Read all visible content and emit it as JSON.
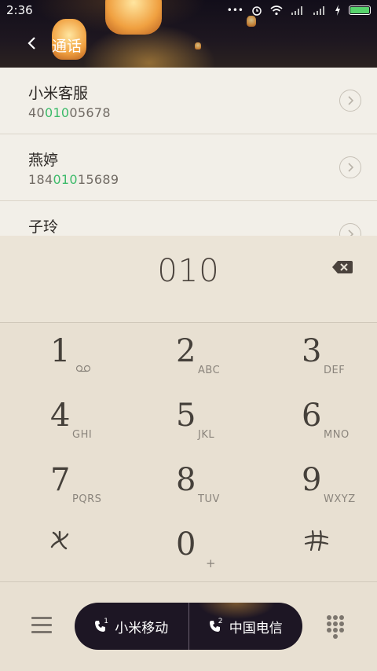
{
  "status_bar": {
    "time": "2:36"
  },
  "header": {
    "title": "通话"
  },
  "results": [
    {
      "name": "小米客服",
      "number_pre": "40",
      "number_match": "010",
      "number_post": "05678"
    },
    {
      "name": "燕婷",
      "number_pre": "184",
      "number_match": "010",
      "number_post": "15689"
    },
    {
      "name": "子玲",
      "number_pre": "",
      "number_match": "",
      "number_post": ""
    }
  ],
  "dialer": {
    "input_value": "010"
  },
  "keys": [
    {
      "digit": "1",
      "letters": ""
    },
    {
      "digit": "2",
      "letters": "ABC"
    },
    {
      "digit": "3",
      "letters": "DEF"
    },
    {
      "digit": "4",
      "letters": "GHI"
    },
    {
      "digit": "5",
      "letters": "JKL"
    },
    {
      "digit": "6",
      "letters": "MNO"
    },
    {
      "digit": "7",
      "letters": "PQRS"
    },
    {
      "digit": "8",
      "letters": "TUV"
    },
    {
      "digit": "9",
      "letters": "WXYZ"
    },
    {
      "digit": "*",
      "letters": ""
    },
    {
      "digit": "0",
      "letters": "+"
    },
    {
      "digit": "#",
      "letters": ""
    }
  ],
  "call_buttons": {
    "sim1": {
      "label": "小米移动",
      "sim": "1"
    },
    "sim2": {
      "label": "中国电信",
      "sim": "2"
    }
  },
  "colors": {
    "match_highlight": "#3dbb6a",
    "call_pill": "#1d1624",
    "battery": "#57d36c"
  }
}
